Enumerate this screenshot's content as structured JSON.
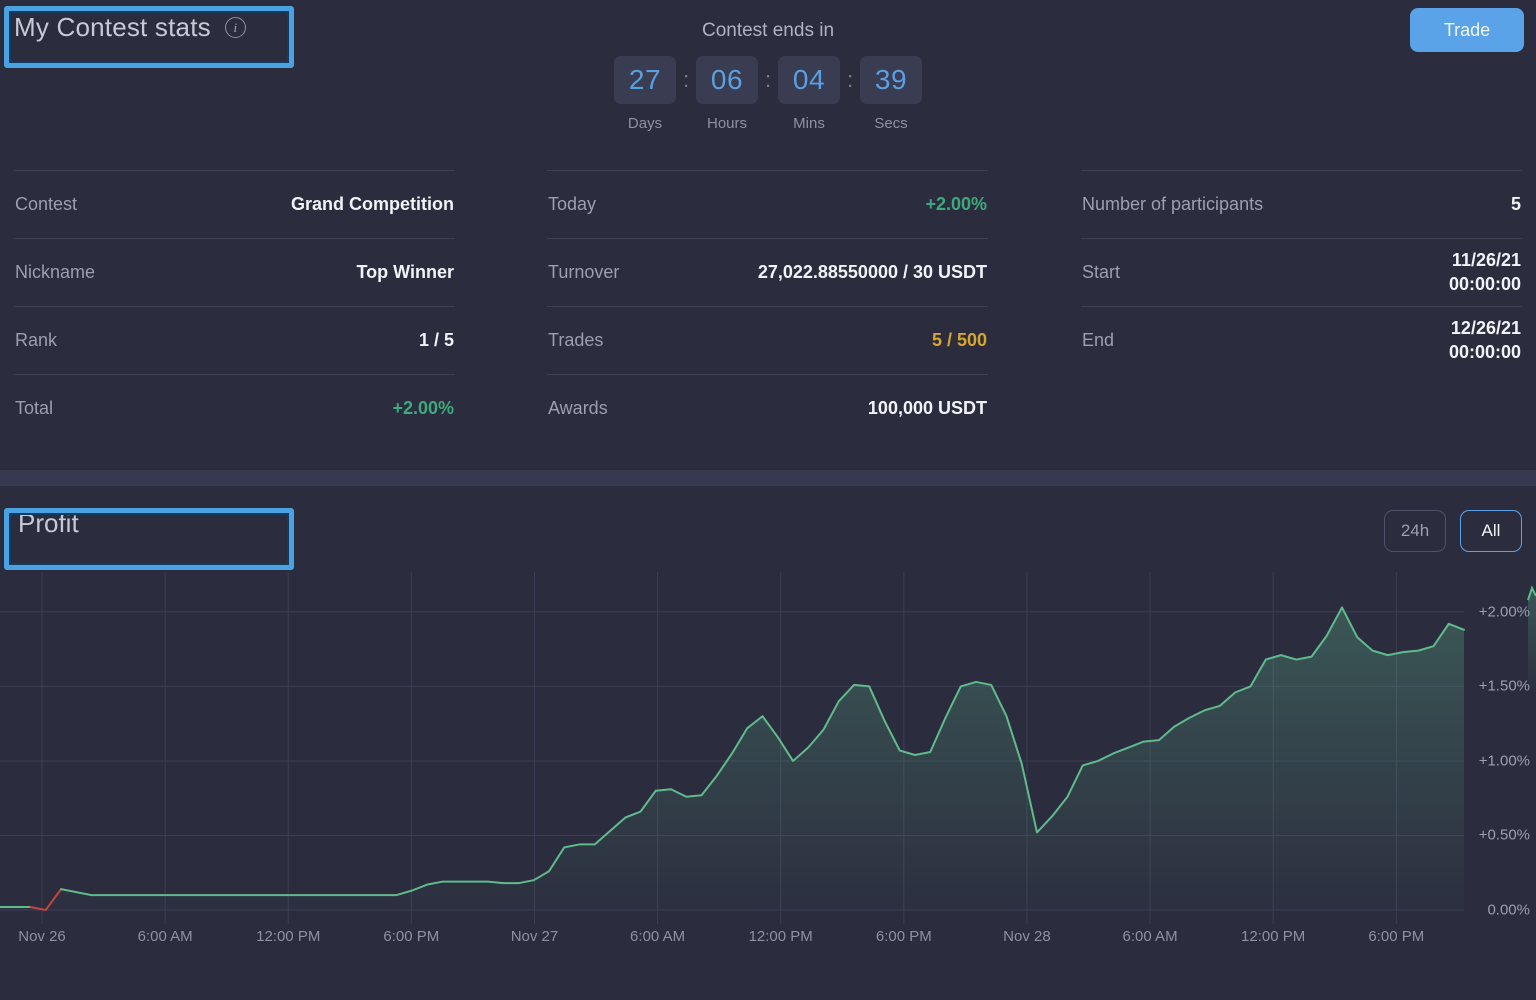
{
  "header": {
    "title": "My Contest stats",
    "info_icon": "info-icon",
    "trade_button": "Trade"
  },
  "countdown": {
    "label": "Contest ends in",
    "separator": ":",
    "units": [
      {
        "value": "27",
        "name": "Days"
      },
      {
        "value": "06",
        "name": "Hours"
      },
      {
        "value": "04",
        "name": "Mins"
      },
      {
        "value": "39",
        "name": "Secs"
      }
    ]
  },
  "stats": {
    "column_1": [
      {
        "label": "Contest",
        "value": "Grand Competition",
        "tone": ""
      },
      {
        "label": "Nickname",
        "value": "Top Winner",
        "tone": ""
      },
      {
        "label": "Rank",
        "value": "1 / 5",
        "tone": ""
      },
      {
        "label": "Total",
        "value": "+2.00%",
        "tone": "green"
      }
    ],
    "column_2": [
      {
        "label": "Today",
        "value": "+2.00%",
        "tone": "green"
      },
      {
        "label": "Turnover",
        "value": "27,022.88550000 / 30 USDT",
        "tone": ""
      },
      {
        "label": "Trades",
        "value": "5 / 500",
        "tone": "gold"
      },
      {
        "label": "Awards",
        "value": "100,000 USDT",
        "tone": ""
      }
    ],
    "column_3": [
      {
        "label": "Number of participants",
        "value": "5",
        "value2": "",
        "tone": ""
      },
      {
        "label": "Start",
        "value": "11/26/21",
        "value2": "00:00:00",
        "tone": ""
      },
      {
        "label": "End",
        "value": "12/26/21",
        "value2": "00:00:00",
        "tone": ""
      }
    ]
  },
  "profit_section": {
    "title": "Profit",
    "range_buttons": [
      {
        "label": "24h",
        "active": false
      },
      {
        "label": "All",
        "active": true
      }
    ]
  },
  "colors": {
    "accent_blue": "#5ba3e8",
    "positive_green": "#3ea97a",
    "warning_gold": "#d6a72e",
    "negative_red": "#c0443f",
    "panel_bg": "#2b2c3e",
    "annotation": "#4aa3e0"
  },
  "chart_data": {
    "type": "area",
    "title": "Profit",
    "xlabel": "",
    "ylabel": "",
    "grid": true,
    "legend": "none",
    "ylim": [
      0.0,
      2.12
    ],
    "y_ticks": [
      0.0,
      0.5,
      1.0,
      1.5,
      2.0
    ],
    "y_tick_labels": [
      "0.00%",
      "+0.50%",
      "+1.00%",
      "+1.50%",
      "+2.00%"
    ],
    "x_tick_labels": [
      "Nov 26",
      "6:00 AM",
      "12:00 PM",
      "6:00 PM",
      "Nov 27",
      "6:00 AM",
      "12:00 PM",
      "6:00 PM",
      "Nov 28",
      "6:00 AM",
      "12:00 PM",
      "6:00 PM"
    ],
    "series": [
      {
        "name": "Profit",
        "unit": "%",
        "line_color": "#5fbb8c",
        "fill_top": "rgba(95,187,140,0.30)",
        "fill_bottom": "rgba(95,187,140,0.02)",
        "negative_color": "#c0443f",
        "values": [
          0.02,
          0.02,
          0.02,
          0.0,
          0.14,
          0.12,
          0.1,
          0.1,
          0.1,
          0.1,
          0.1,
          0.1,
          0.1,
          0.1,
          0.1,
          0.1,
          0.1,
          0.1,
          0.1,
          0.1,
          0.1,
          0.1,
          0.1,
          0.1,
          0.1,
          0.1,
          0.1,
          0.13,
          0.17,
          0.19,
          0.19,
          0.19,
          0.19,
          0.18,
          0.18,
          0.2,
          0.26,
          0.42,
          0.44,
          0.44,
          0.53,
          0.62,
          0.66,
          0.8,
          0.81,
          0.76,
          0.77,
          0.9,
          1.05,
          1.22,
          1.3,
          1.16,
          1.0,
          1.09,
          1.21,
          1.4,
          1.51,
          1.5,
          1.27,
          1.07,
          1.04,
          1.06,
          1.29,
          1.5,
          1.53,
          1.51,
          1.3,
          0.98,
          0.52,
          0.63,
          0.76,
          0.97,
          1.0,
          1.05,
          1.09,
          1.13,
          1.14,
          1.23,
          1.29,
          1.34,
          1.37,
          1.46,
          1.5,
          1.68,
          1.71,
          1.68,
          1.7,
          1.84,
          2.03,
          1.83,
          1.74,
          1.71,
          1.73,
          1.74,
          1.77,
          1.92,
          1.88
        ]
      }
    ]
  }
}
